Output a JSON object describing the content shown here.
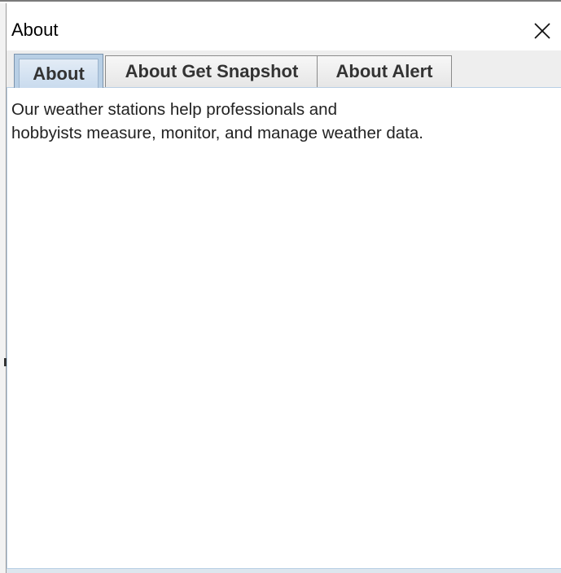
{
  "window": {
    "title": "About",
    "close_icon": "close-icon"
  },
  "tabs": [
    {
      "label": "About",
      "selected": true
    },
    {
      "label": "About Get Snapshot",
      "selected": false
    },
    {
      "label": "About Alert",
      "selected": false
    }
  ],
  "content": {
    "line1": "Our weather stations help professionals and",
    "line2": "hobbyists measure, monitor, and manage weather data."
  },
  "colors": {
    "tab_selected": "#b8cfe5",
    "tab_background": "#eeeeee"
  }
}
